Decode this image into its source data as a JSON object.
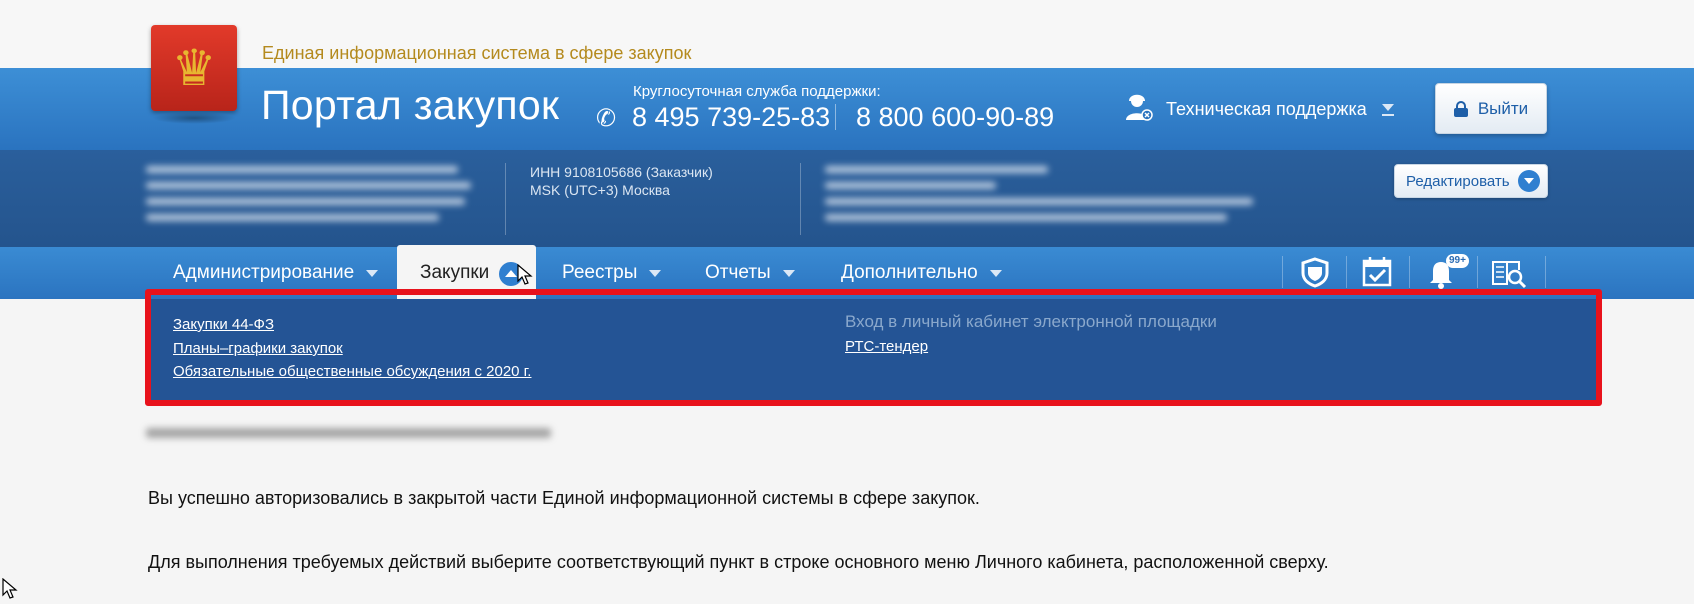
{
  "header": {
    "system_title": "Единая информационная система в сфере закупок",
    "portal_title": "Портал закупок",
    "support_label": "Круглосуточная служба поддержки:",
    "phone_1": "8 495 739-25-83",
    "phone_2": "8 800 600-90-89",
    "tech_support": "Техническая поддержка",
    "logout_label": "Выйти"
  },
  "org": {
    "inn": "ИНН 9108105686 (Заказчик)",
    "timezone": "MSK (UTC+3) Москва",
    "edit_label": "Редактировать"
  },
  "nav": {
    "items": [
      {
        "label": "Администрирование"
      },
      {
        "label": "Закупки",
        "active": true
      },
      {
        "label": "Реестры"
      },
      {
        "label": "Отчеты"
      },
      {
        "label": "Дополнительно"
      }
    ],
    "icons": [
      "shield-icon",
      "calendar-check-icon",
      "bell-icon",
      "catalog-search-icon"
    ],
    "notification_count": "99+"
  },
  "dropdown": {
    "left_links": [
      "Закупки 44-ФЗ",
      "Планы–графики закупок",
      "Обязательные общественные обсуждения с 2020 г."
    ],
    "right_heading": "Вход в личный кабинет электронной площадки",
    "right_links": [
      "РТС-тендер"
    ]
  },
  "main": {
    "message_1": "Вы успешно авторизовались в закрытой части Единой информационной системы в сфере закупок.",
    "message_2": "Для выполнения требуемых действий выберите соответствующий пункт в строке основного меню Личного кабинета, расположенной сверху."
  },
  "colors": {
    "header_blue": "#2f7fcb",
    "org_blue": "#27579a",
    "highlight_red": "#e8121c",
    "gold_text": "#b48a1e"
  }
}
